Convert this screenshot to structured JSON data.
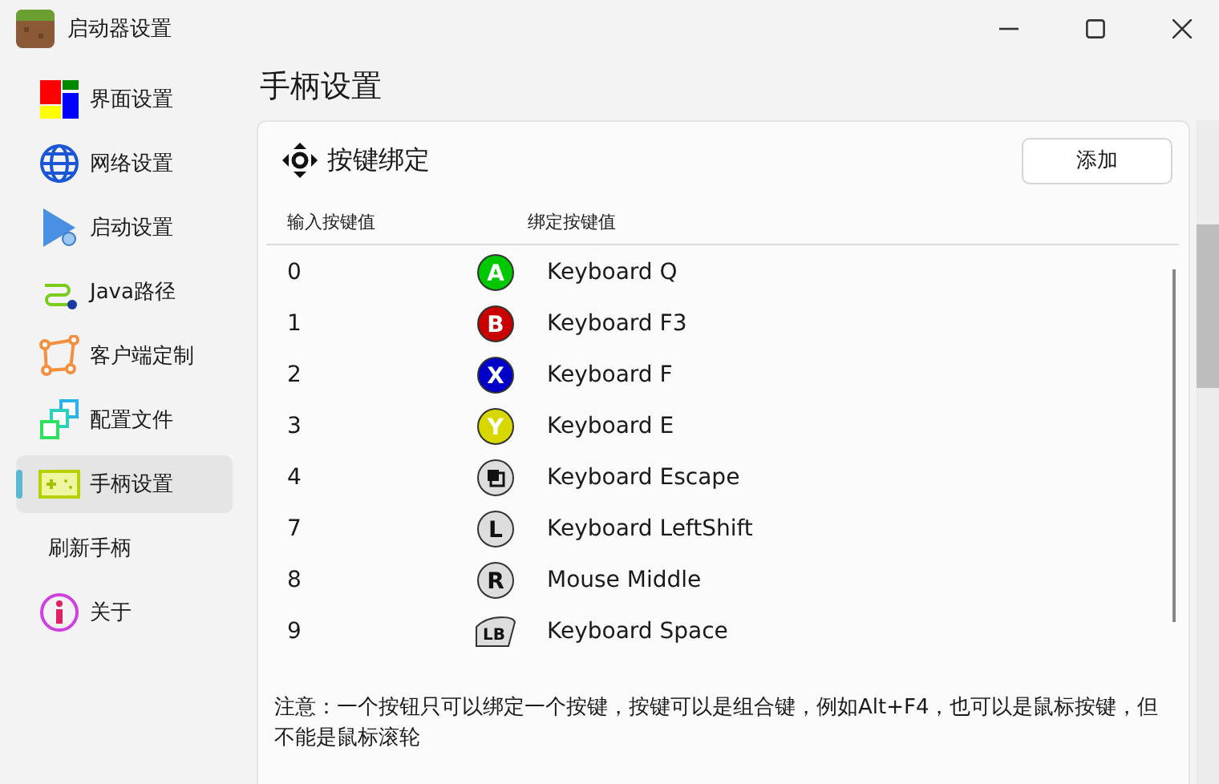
{
  "window": {
    "title": "启动器设置"
  },
  "sidebar": {
    "items": [
      {
        "label": "界面设置",
        "selected": false
      },
      {
        "label": "网络设置",
        "selected": false
      },
      {
        "label": "启动设置",
        "selected": false
      },
      {
        "label": "Java路径",
        "selected": false
      },
      {
        "label": "客户端定制",
        "selected": false
      },
      {
        "label": "配置文件",
        "selected": false
      },
      {
        "label": "手柄设置",
        "selected": true
      },
      {
        "label": "刷新手柄",
        "selected": false
      },
      {
        "label": "关于",
        "selected": false
      }
    ]
  },
  "page_title": "手柄设置",
  "card": {
    "title": "按键绑定",
    "add_button": "添加",
    "columns": [
      "输入按键值",
      "绑定按键值"
    ],
    "rows": [
      {
        "input": "0",
        "kind": "face",
        "label": "A",
        "color": "#00c800",
        "binding": "Keyboard Q"
      },
      {
        "input": "1",
        "kind": "face",
        "label": "B",
        "color": "#c80000",
        "binding": "Keyboard F3"
      },
      {
        "input": "2",
        "kind": "face",
        "label": "X",
        "color": "#0000c8",
        "binding": "Keyboard F"
      },
      {
        "input": "3",
        "kind": "face",
        "label": "Y",
        "color": "#d8d800",
        "binding": "Keyboard E"
      },
      {
        "input": "4",
        "kind": "view",
        "binding": "Keyboard Escape"
      },
      {
        "input": "7",
        "kind": "stick",
        "label": "L",
        "binding": "Keyboard LeftShift"
      },
      {
        "input": "8",
        "kind": "stick",
        "label": "R",
        "binding": "Mouse Middle"
      },
      {
        "input": "9",
        "kind": "bumper",
        "label": "LB",
        "binding": "Keyboard Space"
      }
    ],
    "note": "注意：一个按钮只可以绑定一个按键，按键可以是组合键，例如Alt+F4，也可以是鼠标按键，但不能是鼠标滚轮"
  }
}
